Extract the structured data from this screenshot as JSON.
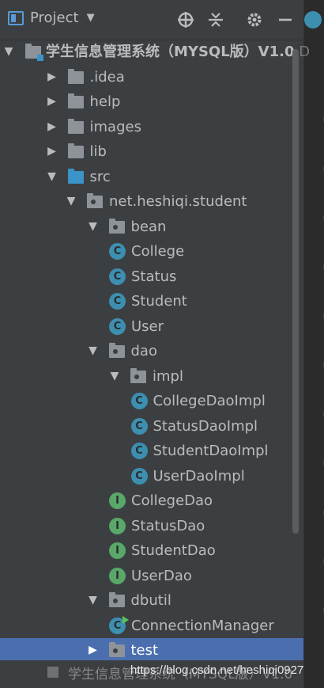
{
  "header": {
    "title": "Project",
    "caret": "▼",
    "icons": [
      "target-icon",
      "collapse-icon",
      "gear-icon",
      "minimize-icon"
    ]
  },
  "tree": {
    "module": {
      "name": "学生信息管理系统（MYSQL版）V1.0",
      "suffix": "D"
    },
    "items": [
      {
        "label": ".idea",
        "type": "folder",
        "level": 1,
        "arrow": "▶"
      },
      {
        "label": "help",
        "type": "folder",
        "level": 1,
        "arrow": "▶"
      },
      {
        "label": "images",
        "type": "folder",
        "level": 1,
        "arrow": "▶"
      },
      {
        "label": "lib",
        "type": "folder",
        "level": 1,
        "arrow": "▶"
      },
      {
        "label": "src",
        "type": "src-folder",
        "level": 1,
        "arrow": "▼"
      },
      {
        "label": "net.heshiqi.student",
        "type": "package",
        "level": 2,
        "arrow": "▼"
      },
      {
        "label": "bean",
        "type": "package",
        "level": 3,
        "arrow": "▼"
      },
      {
        "label": "College",
        "type": "class",
        "level": 4
      },
      {
        "label": "Status",
        "type": "class",
        "level": 4
      },
      {
        "label": "Student",
        "type": "class",
        "level": 4
      },
      {
        "label": "User",
        "type": "class",
        "level": 4
      },
      {
        "label": "dao",
        "type": "package",
        "level": 3,
        "arrow": "▼"
      },
      {
        "label": "impl",
        "type": "package",
        "level": 4,
        "arrow": "▼"
      },
      {
        "label": "CollegeDaoImpl",
        "type": "class",
        "level": 5
      },
      {
        "label": "StatusDaoImpl",
        "type": "class",
        "level": 5
      },
      {
        "label": "StudentDaoImpl",
        "type": "class",
        "level": 5
      },
      {
        "label": "UserDaoImpl",
        "type": "class",
        "level": 5
      },
      {
        "label": "CollegeDao",
        "type": "interface",
        "level": 4
      },
      {
        "label": "StatusDao",
        "type": "interface",
        "level": 4
      },
      {
        "label": "StudentDao",
        "type": "interface",
        "level": 4
      },
      {
        "label": "UserDao",
        "type": "interface",
        "level": 4
      },
      {
        "label": "dbutil",
        "type": "package",
        "level": 3,
        "arrow": "▼"
      },
      {
        "label": "ConnectionManager",
        "type": "runnable-class",
        "level": 4
      },
      {
        "label": "test",
        "type": "package",
        "level": 3,
        "arrow": "▶",
        "selected": true
      }
    ],
    "partial_bottom": "学生信息管理系统（MYSQL版）V1.0"
  },
  "icon_glyphs": {
    "class": "C",
    "interface": "I"
  },
  "watermark": "https://blog.csdn.net/heshiqi0927",
  "colors": {
    "background": "#3c3f41",
    "selection": "#4b6eaf",
    "class_icon": "#3d8fb0",
    "interface_icon": "#59a869",
    "source_folder": "#3a94c8",
    "text": "#bbbbbb"
  }
}
